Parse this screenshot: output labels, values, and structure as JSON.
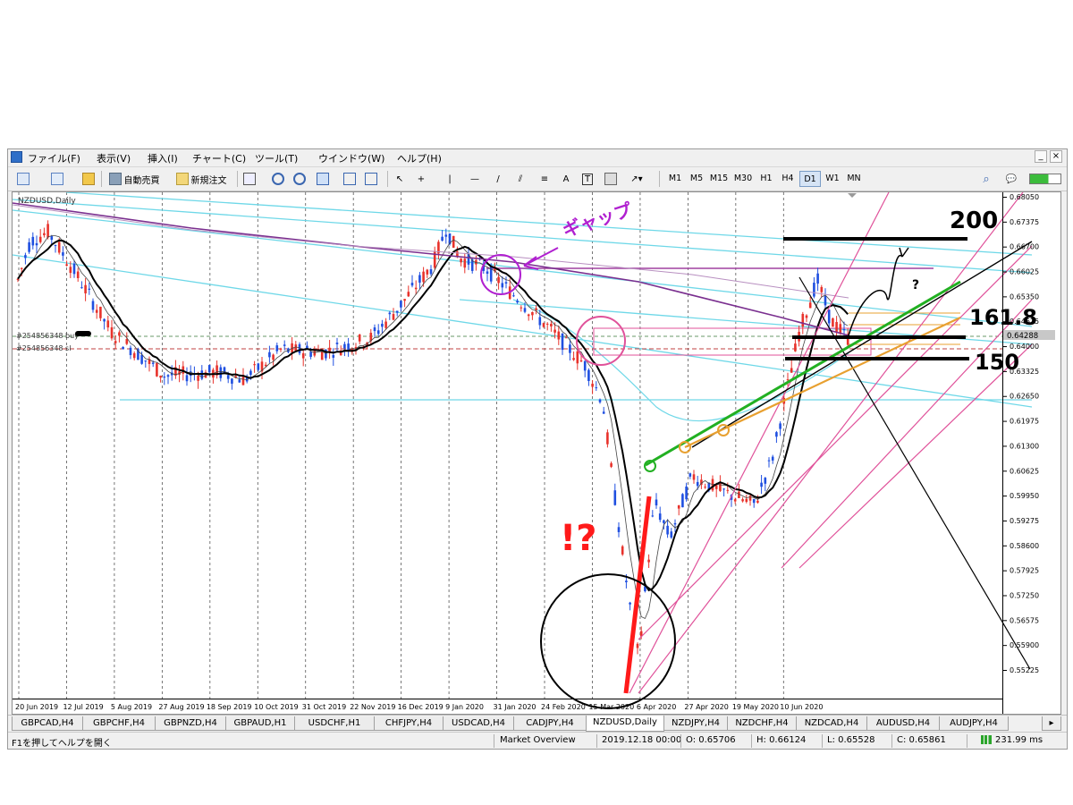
{
  "menu": [
    "ファイル(F)",
    "表示(V)",
    "挿入(I)",
    "チャート(C)",
    "ツール(T)",
    "ウインドウ(W)",
    "ヘルプ(H)"
  ],
  "toolbar": {
    "auto_trading": "自動売買",
    "new_order": "新規注文",
    "timeframes": [
      "M1",
      "M5",
      "M15",
      "M30",
      "H1",
      "H4",
      "D1",
      "W1",
      "MN"
    ],
    "active_timeframe": "D1"
  },
  "chart": {
    "title": "NZDUSD,Daily",
    "order_buy_label": "#254856348 buy",
    "order_sl_label": "#254856348 sl",
    "current_price": "0.64288",
    "price_ticks": [
      "0.68050",
      "0.67375",
      "0.66700",
      "0.66025",
      "0.65350",
      "0.64675",
      "0.64000",
      "0.63325",
      "0.62650",
      "0.61975",
      "0.61300",
      "0.60625",
      "0.59950",
      "0.59275",
      "0.58600",
      "0.57925",
      "0.57250",
      "0.56575",
      "0.55900",
      "0.55225"
    ],
    "date_ticks": [
      "20 Jun 2019",
      "12 Jul 2019",
      "5 Aug 2019",
      "27 Aug 2019",
      "18 Sep 2019",
      "10 Oct 2019",
      "31 Oct 2019",
      "22 Nov 2019",
      "16 Dec 2019",
      "9 Jan 2020",
      "31 Jan 2020",
      "24 Feb 2020",
      "15 Mar 2020",
      "6 Apr 2020",
      "27 Apr 2020",
      "19 May 2020",
      "10 Jun 2020"
    ],
    "colors": {
      "up": "#e8322b",
      "down": "#1f4fe0",
      "ma_fast": "#000000",
      "ma_slow": "#7a2f8f",
      "cyan": "#6fd8e8",
      "pink": "#e0529a",
      "green": "#22b022",
      "orange": "#e8a030",
      "red_mark": "#ff1a1a"
    }
  },
  "annotations": {
    "gap": "ギャップ",
    "level_200": "200",
    "level_1618": "161.8",
    "level_150": "150",
    "question": "?",
    "exclaim_question": "!?"
  },
  "symbol_tabs": [
    "GBPCAD,H4",
    "GBPCHF,H4",
    "GBPNZD,H4",
    "GBPAUD,H1",
    "USDCHF,H1",
    "CHFJPY,H4",
    "USDCAD,H4",
    "CADJPY,H4",
    "NZDUSD,Daily",
    "NZDJPY,H4",
    "NZDCHF,H4",
    "NZDCAD,H4",
    "AUDUSD,H4",
    "AUDJPY,H4"
  ],
  "active_tab": "NZDUSD,Daily",
  "status": {
    "help": "F1を押してヘルプを開く",
    "profile": "Market Overview",
    "datetime": "2019.12.18 00:00",
    "open": "O: 0.65706",
    "high": "H: 0.66124",
    "low": "L: 0.65528",
    "close": "C: 0.65861",
    "ping": "231.99 ms"
  }
}
